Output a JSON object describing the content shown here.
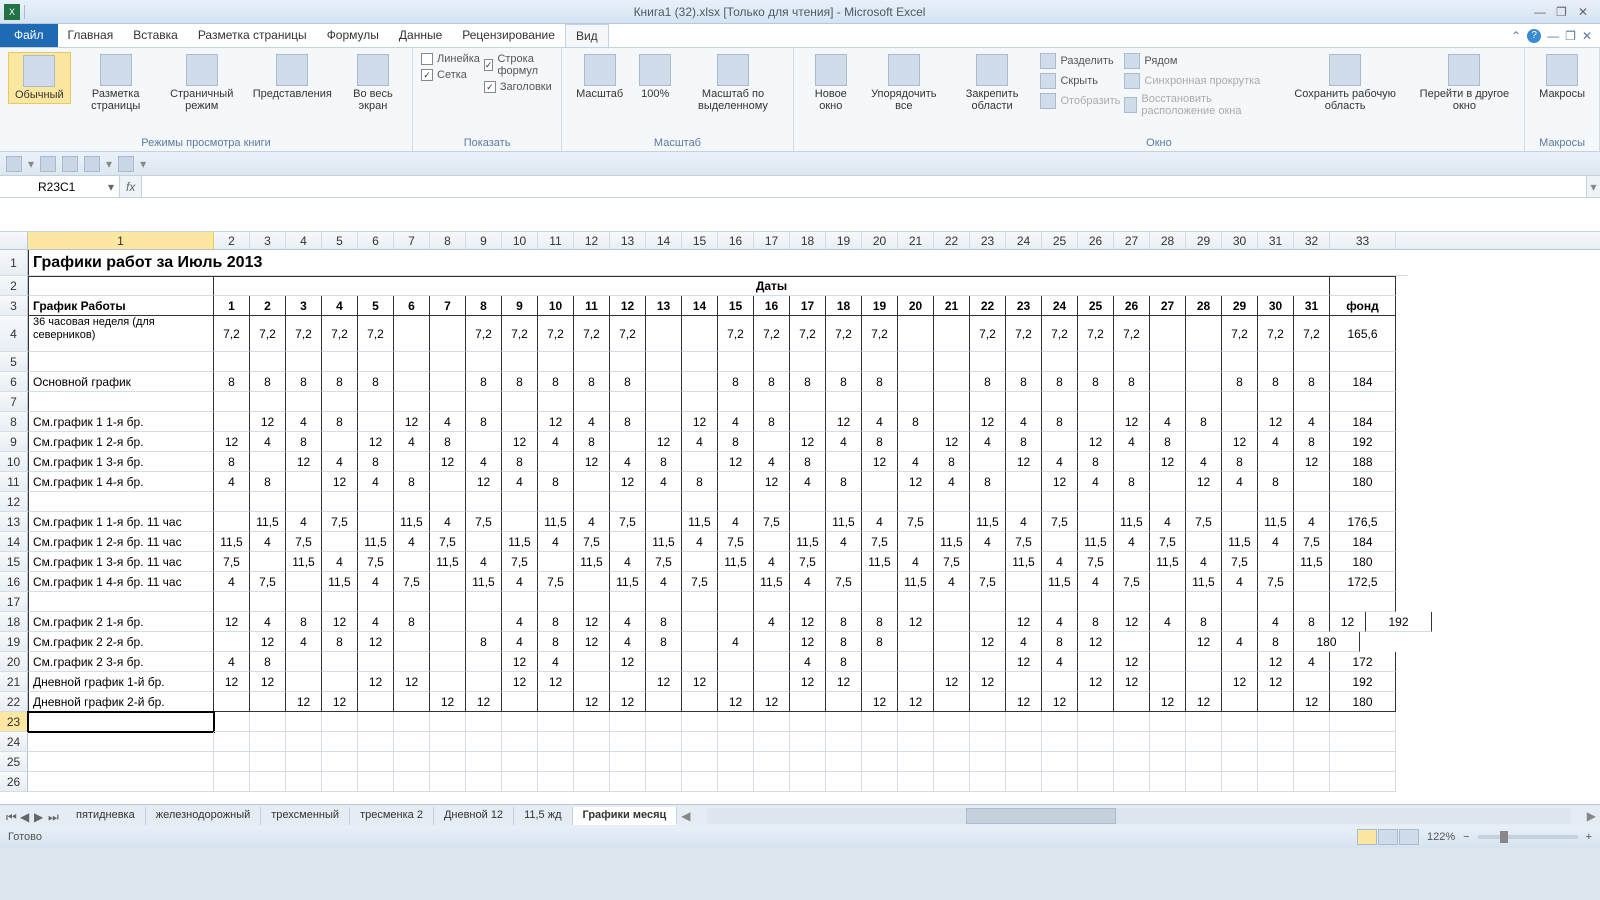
{
  "app_title": "Книга1 (32).xlsx  [Только для чтения] - Microsoft Excel",
  "menu": {
    "file": "Файл",
    "items": [
      "Главная",
      "Вставка",
      "Разметка страницы",
      "Формулы",
      "Данные",
      "Рецензирование",
      "Вид"
    ],
    "active": "Вид"
  },
  "ribbon": {
    "views": {
      "normal": "Обычный",
      "page_layout": "Разметка страницы",
      "page_break": "Страничный режим",
      "custom": "Представления",
      "full": "Во весь экран",
      "group": "Режимы просмотра книги"
    },
    "show": {
      "ruler": "Линейка",
      "formula_bar": "Строка формул",
      "gridlines": "Сетка",
      "headings": "Заголовки",
      "group": "Показать"
    },
    "zoom": {
      "zoom": "Масштаб",
      "hundred": "100%",
      "selection": "Масштаб по выделенному",
      "group": "Масштаб"
    },
    "window": {
      "new": "Новое окно",
      "arrange": "Упорядочить все",
      "freeze": "Закрепить области",
      "split": "Разделить",
      "hide": "Скрыть",
      "unhide": "Отобразить",
      "side": "Рядом",
      "sync": "Синхронная прокрутка",
      "reset": "Восстановить расположение окна",
      "save": "Сохранить рабочую область",
      "switch": "Перейти в другое окно",
      "group": "Окно"
    },
    "macros": {
      "macros": "Макросы",
      "group": "Макросы"
    }
  },
  "namebox": "R23C1",
  "col_headers": [
    "1",
    "2",
    "3",
    "4",
    "5",
    "6",
    "7",
    "8",
    "9",
    "10",
    "11",
    "12",
    "13",
    "14",
    "15",
    "16",
    "17",
    "18",
    "19",
    "20",
    "21",
    "22",
    "23",
    "24",
    "25",
    "26",
    "27",
    "28",
    "29",
    "30",
    "31",
    "32",
    "33"
  ],
  "sheet": {
    "title": "Графики работ за Июль 2013",
    "dates_header": "Даты",
    "schedule_header": "График Работы",
    "fund_header": "фонд",
    "days": [
      "1",
      "2",
      "3",
      "4",
      "5",
      "6",
      "7",
      "8",
      "9",
      "10",
      "11",
      "12",
      "13",
      "14",
      "15",
      "16",
      "17",
      "18",
      "19",
      "20",
      "21",
      "22",
      "23",
      "24",
      "25",
      "26",
      "27",
      "28",
      "29",
      "30",
      "31"
    ],
    "rows": [
      {
        "r": 4,
        "label": "36 часовая неделя (для северников)",
        "cells": [
          "7,2",
          "7,2",
          "7,2",
          "7,2",
          "7,2",
          "",
          "",
          "7,2",
          "7,2",
          "7,2",
          "7,2",
          "7,2",
          "",
          "",
          "7,2",
          "7,2",
          "7,2",
          "7,2",
          "7,2",
          "",
          "",
          "7,2",
          "7,2",
          "7,2",
          "7,2",
          "7,2",
          "",
          "",
          "7,2",
          "7,2",
          "7,2"
        ],
        "fund": "165,6"
      },
      {
        "r": 5,
        "label": "",
        "cells": [
          "",
          "",
          "",
          "",
          "",
          "",
          "",
          "",
          "",
          "",
          "",
          "",
          "",
          "",
          "",
          "",
          "",
          "",
          "",
          "",
          "",
          "",
          "",
          "",
          "",
          "",
          "",
          "",
          "",
          "",
          ""
        ],
        "fund": ""
      },
      {
        "r": 6,
        "label": "Основной график",
        "cells": [
          "8",
          "8",
          "8",
          "8",
          "8",
          "",
          "",
          "8",
          "8",
          "8",
          "8",
          "8",
          "",
          "",
          "8",
          "8",
          "8",
          "8",
          "8",
          "",
          "",
          "8",
          "8",
          "8",
          "8",
          "8",
          "",
          "",
          "8",
          "8",
          "8"
        ],
        "fund": "184"
      },
      {
        "r": 7,
        "label": "",
        "cells": [
          "",
          "",
          "",
          "",
          "",
          "",
          "",
          "",
          "",
          "",
          "",
          "",
          "",
          "",
          "",
          "",
          "",
          "",
          "",
          "",
          "",
          "",
          "",
          "",
          "",
          "",
          "",
          "",
          "",
          "",
          ""
        ],
        "fund": ""
      },
      {
        "r": 8,
        "label": "См.график 1   1-я бр.",
        "cells": [
          "",
          "12",
          "4",
          "8",
          "",
          "12",
          "4",
          "8",
          "",
          "12",
          "4",
          "8",
          "",
          "12",
          "4",
          "8",
          "",
          "12",
          "4",
          "8",
          "",
          "12",
          "4",
          "8",
          "",
          "12",
          "4",
          "8",
          "",
          "12",
          "4"
        ],
        "fund": "184"
      },
      {
        "r": 9,
        "label": "См.график 1   2-я бр.",
        "cells": [
          "12",
          "4",
          "8",
          "",
          "12",
          "4",
          "8",
          "",
          "12",
          "4",
          "8",
          "",
          "12",
          "4",
          "8",
          "",
          "12",
          "4",
          "8",
          "",
          "12",
          "4",
          "8",
          "",
          "12",
          "4",
          "8",
          "",
          "12",
          "4",
          "8"
        ],
        "fund": "192"
      },
      {
        "r": 10,
        "label": "См.график 1   3-я бр.",
        "cells": [
          "8",
          "",
          "12",
          "4",
          "8",
          "",
          "12",
          "4",
          "8",
          "",
          "12",
          "4",
          "8",
          "",
          "12",
          "4",
          "8",
          "",
          "12",
          "4",
          "8",
          "",
          "12",
          "4",
          "8",
          "",
          "12",
          "4",
          "8",
          "",
          "12"
        ],
        "fund": "188"
      },
      {
        "r": 11,
        "label": "См.график 1   4-я бр.",
        "cells": [
          "4",
          "8",
          "",
          "12",
          "4",
          "8",
          "",
          "12",
          "4",
          "8",
          "",
          "12",
          "4",
          "8",
          "",
          "12",
          "4",
          "8",
          "",
          "12",
          "4",
          "8",
          "",
          "12",
          "4",
          "8",
          "",
          "12",
          "4",
          "8",
          ""
        ],
        "fund": "180"
      },
      {
        "r": 12,
        "label": "",
        "cells": [
          "",
          "",
          "",
          "",
          "",
          "",
          "",
          "",
          "",
          "",
          "",
          "",
          "",
          "",
          "",
          "",
          "",
          "",
          "",
          "",
          "",
          "",
          "",
          "",
          "",
          "",
          "",
          "",
          "",
          "",
          ""
        ],
        "fund": ""
      },
      {
        "r": 13,
        "label": "См.график 1   1-я бр. 11 час",
        "cells": [
          "",
          "11,5",
          "4",
          "7,5",
          "",
          "11,5",
          "4",
          "7,5",
          "",
          "11,5",
          "4",
          "7,5",
          "",
          "11,5",
          "4",
          "7,5",
          "",
          "11,5",
          "4",
          "7,5",
          "",
          "11,5",
          "4",
          "7,5",
          "",
          "11,5",
          "4",
          "7,5",
          "",
          "11,5",
          "4"
        ],
        "fund": "176,5"
      },
      {
        "r": 14,
        "label": "См.график 1   2-я бр. 11 час",
        "cells": [
          "11,5",
          "4",
          "7,5",
          "",
          "11,5",
          "4",
          "7,5",
          "",
          "11,5",
          "4",
          "7,5",
          "",
          "11,5",
          "4",
          "7,5",
          "",
          "11,5",
          "4",
          "7,5",
          "",
          "11,5",
          "4",
          "7,5",
          "",
          "11,5",
          "4",
          "7,5",
          "",
          "11,5",
          "4",
          "7,5"
        ],
        "fund": "184"
      },
      {
        "r": 15,
        "label": "См.график 1   3-я бр. 11 час",
        "cells": [
          "7,5",
          "",
          "11,5",
          "4",
          "7,5",
          "",
          "11,5",
          "4",
          "7,5",
          "",
          "11,5",
          "4",
          "7,5",
          "",
          "11,5",
          "4",
          "7,5",
          "",
          "11,5",
          "4",
          "7,5",
          "",
          "11,5",
          "4",
          "7,5",
          "",
          "11,5",
          "4",
          "7,5",
          "",
          "11,5"
        ],
        "fund": "180"
      },
      {
        "r": 16,
        "label": "См.график 1   4-я бр. 11 час",
        "cells": [
          "4",
          "7,5",
          "",
          "11,5",
          "4",
          "7,5",
          "",
          "11,5",
          "4",
          "7,5",
          "",
          "11,5",
          "4",
          "7,5",
          "",
          "11,5",
          "4",
          "7,5",
          "",
          "11,5",
          "4",
          "7,5",
          "",
          "11,5",
          "4",
          "7,5",
          "",
          "11,5",
          "4",
          "7,5",
          ""
        ],
        "fund": "172,5"
      },
      {
        "r": 17,
        "label": "",
        "cells": [
          "",
          "",
          "",
          "",
          "",
          "",
          "",
          "",
          "",
          "",
          "",
          "",
          "",
          "",
          "",
          "",
          "",
          "",
          "",
          "",
          "",
          "",
          "",
          "",
          "",
          "",
          "",
          "",
          "",
          "",
          ""
        ],
        "fund": ""
      },
      {
        "r": 18,
        "label": "См.график 2   1-я бр.",
        "cells": [
          "12",
          "4",
          "8",
          "12",
          "4",
          "8",
          "",
          "",
          "4",
          "8",
          "12",
          "4",
          "8",
          "",
          "",
          "4",
          "12",
          "8",
          "8",
          "12",
          "",
          "",
          "12",
          "4",
          "8",
          "12",
          "4",
          "8",
          "",
          "4",
          "8",
          "12"
        ],
        "fund": "192"
      },
      {
        "r": 19,
        "label": "См.график 2   2-я бр.",
        "cells": [
          "",
          "12",
          "4",
          "8",
          "12",
          "",
          "",
          "8",
          "4",
          "8",
          "12",
          "4",
          "8",
          "",
          "4",
          "",
          "12",
          "8",
          "8",
          "",
          "",
          "12",
          "4",
          "8",
          "12",
          "",
          "",
          "12",
          "4",
          "8"
        ],
        "fund": "180"
      },
      {
        "r": 20,
        "label": "См.график 2   3-я бр.",
        "cells": [
          "4",
          "8",
          "",
          "",
          "",
          "",
          "",
          "",
          "12",
          "4",
          "",
          "12",
          "",
          "",
          "",
          "",
          "4",
          "8",
          "",
          "",
          "",
          "",
          "12",
          "4",
          "",
          "12",
          "",
          "",
          "",
          "12",
          "4"
        ],
        "fund": "172"
      },
      {
        "r": 21,
        "label": "Дневной график 1-й бр.",
        "cells": [
          "12",
          "12",
          "",
          "",
          "12",
          "12",
          "",
          "",
          "12",
          "12",
          "",
          "",
          "12",
          "12",
          "",
          "",
          "12",
          "12",
          "",
          "",
          "12",
          "12",
          "",
          "",
          "12",
          "12",
          "",
          "",
          "12",
          "12",
          ""
        ],
        "fund": "192"
      },
      {
        "r": 22,
        "label": "Дневной график 2-й бр.",
        "cells": [
          "",
          "",
          "12",
          "12",
          "",
          "",
          "12",
          "12",
          "",
          "",
          "12",
          "12",
          "",
          "",
          "12",
          "12",
          "",
          "",
          "12",
          "12",
          "",
          "",
          "12",
          "12",
          "",
          "",
          "12",
          "12",
          "",
          "",
          "12"
        ],
        "fund": "180"
      }
    ]
  },
  "tabs": {
    "items": [
      "пятидневка",
      "железнодорожный",
      "трехсменный",
      "тресменка 2",
      "Дневной 12",
      "11,5 жд",
      "Графики месяц"
    ],
    "active": "Графики месяц"
  },
  "status": {
    "ready": "Готово",
    "zoom": "122%"
  }
}
